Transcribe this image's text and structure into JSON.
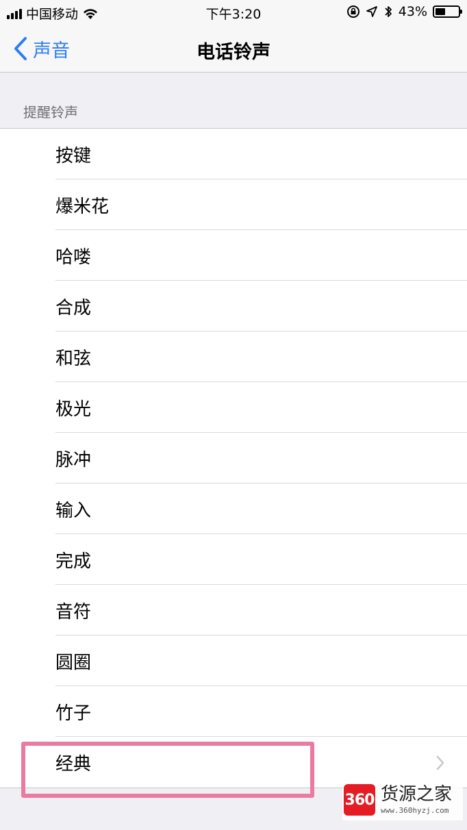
{
  "status_bar": {
    "carrier": "中国移动",
    "time": "下午3:20",
    "battery_percent": "43%",
    "battery_level": 0.43
  },
  "nav": {
    "back_label": "声音",
    "title": "电话铃声"
  },
  "section": {
    "header": "提醒铃声",
    "items": [
      {
        "label": "按键"
      },
      {
        "label": "爆米花"
      },
      {
        "label": "哈喽"
      },
      {
        "label": "合成"
      },
      {
        "label": "和弦"
      },
      {
        "label": "极光"
      },
      {
        "label": "脉冲"
      },
      {
        "label": "输入"
      },
      {
        "label": "完成"
      },
      {
        "label": "音符"
      },
      {
        "label": "圆圈"
      },
      {
        "label": "竹子"
      },
      {
        "label": "经典"
      }
    ]
  },
  "watermark": {
    "logo_text": "360",
    "name": "货源之家",
    "url": "www.360hyzj.com"
  },
  "colors": {
    "accent": "#2f7df6",
    "highlight": "#ec7aa0",
    "watermark_red": "#e51c23"
  },
  "icons": {
    "back": "chevron-left-icon",
    "disclosure": "chevron-right-icon",
    "wifi": "wifi-icon",
    "lock": "orientation-lock-icon",
    "location": "location-arrow-icon",
    "bluetooth": "bluetooth-icon"
  }
}
